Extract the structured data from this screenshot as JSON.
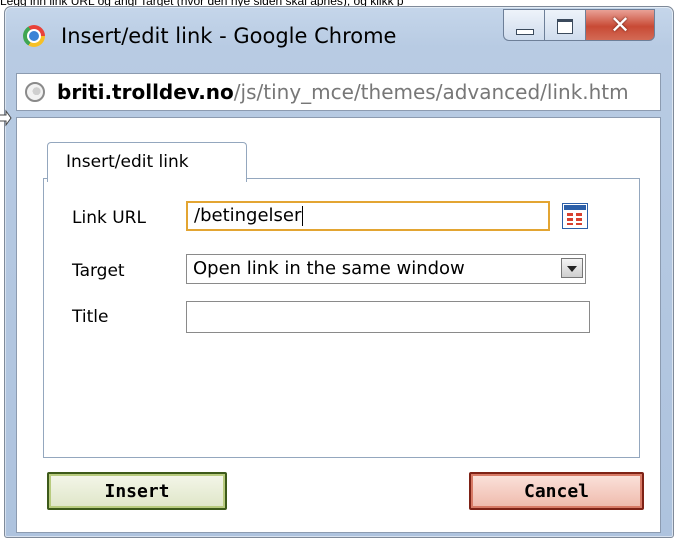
{
  "caption": "Legg inn link URL og angi Target (hvor den nye siden skal åpnes), og klikk p",
  "window": {
    "title": "Insert/edit link - Google Chrome",
    "url_host": "briti.trolldev.no",
    "url_path": "/js/tiny_mce/themes/advanced/link.htm"
  },
  "dialog": {
    "tab_label": "Insert/edit link",
    "fields": {
      "link_url_label": "Link URL",
      "link_url_value": "/betingelser",
      "target_label": "Target",
      "target_value": "Open link in the same window",
      "title_label": "Title",
      "title_value": ""
    },
    "buttons": {
      "insert_label": "Insert",
      "cancel_label": "Cancel"
    }
  },
  "icons": {
    "app": "chrome-icon",
    "address": "globe-icon",
    "browse": "browse-icon",
    "minimize": "minimize-icon",
    "maximize": "maximize-icon",
    "close": "close-icon"
  },
  "colors": {
    "titlebar": "#b8cbe3",
    "active_field_border": "#e3a532",
    "insert_border": "#3d5a1a",
    "cancel_border": "#7e2216",
    "close_button": "#c84a35"
  }
}
